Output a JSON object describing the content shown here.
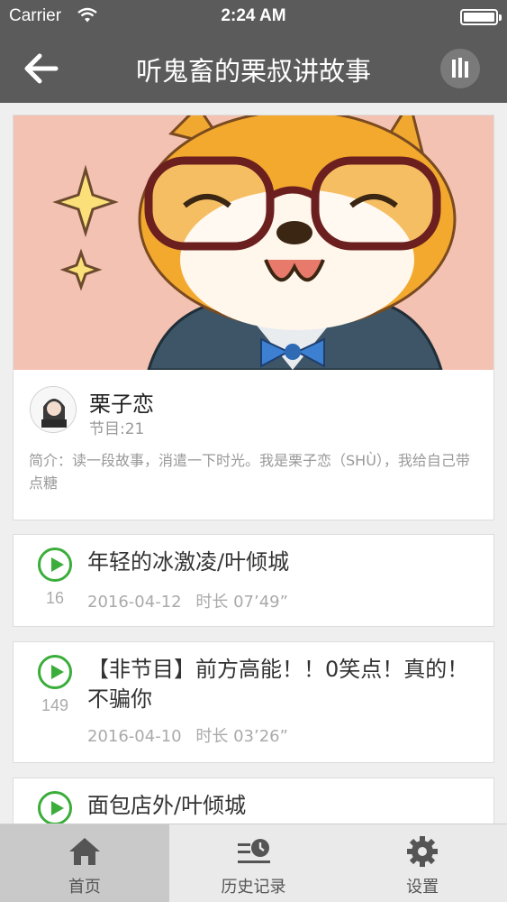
{
  "status_bar": {
    "carrier": "Carrier",
    "time": "2:24 AM"
  },
  "nav": {
    "title": "听鬼畜的栗叔讲故事",
    "back_icon": "back-arrow-icon",
    "player_icon": "equalizer-icon"
  },
  "profile": {
    "name": "栗子恋",
    "program_count": "节目:21",
    "intro": "简介：读一段故事，消遣一下时光。我是栗子恋（SHÙ），我给自己带点糖"
  },
  "episodes": [
    {
      "index": "16",
      "title": "年轻的冰激凌/叶倾城",
      "date": "2016-04-12",
      "duration": "时长 07’49”"
    },
    {
      "index": "149",
      "title": "【非节目】前方高能！！0笑点！真的！不骗你",
      "date": "2016-04-10",
      "duration": "时长 03’26”"
    },
    {
      "index": "",
      "title": "面包店外/叶倾城",
      "date": "",
      "duration": ""
    }
  ],
  "tabs": [
    {
      "label": "首页",
      "icon": "home-icon",
      "active": true
    },
    {
      "label": "历史记录",
      "icon": "history-icon",
      "active": false
    },
    {
      "label": "设置",
      "icon": "gear-icon",
      "active": false
    }
  ],
  "colors": {
    "bar": "#5b5b5b",
    "accent_green": "#3aad3a",
    "banner_bg": "#f4c2b2"
  }
}
